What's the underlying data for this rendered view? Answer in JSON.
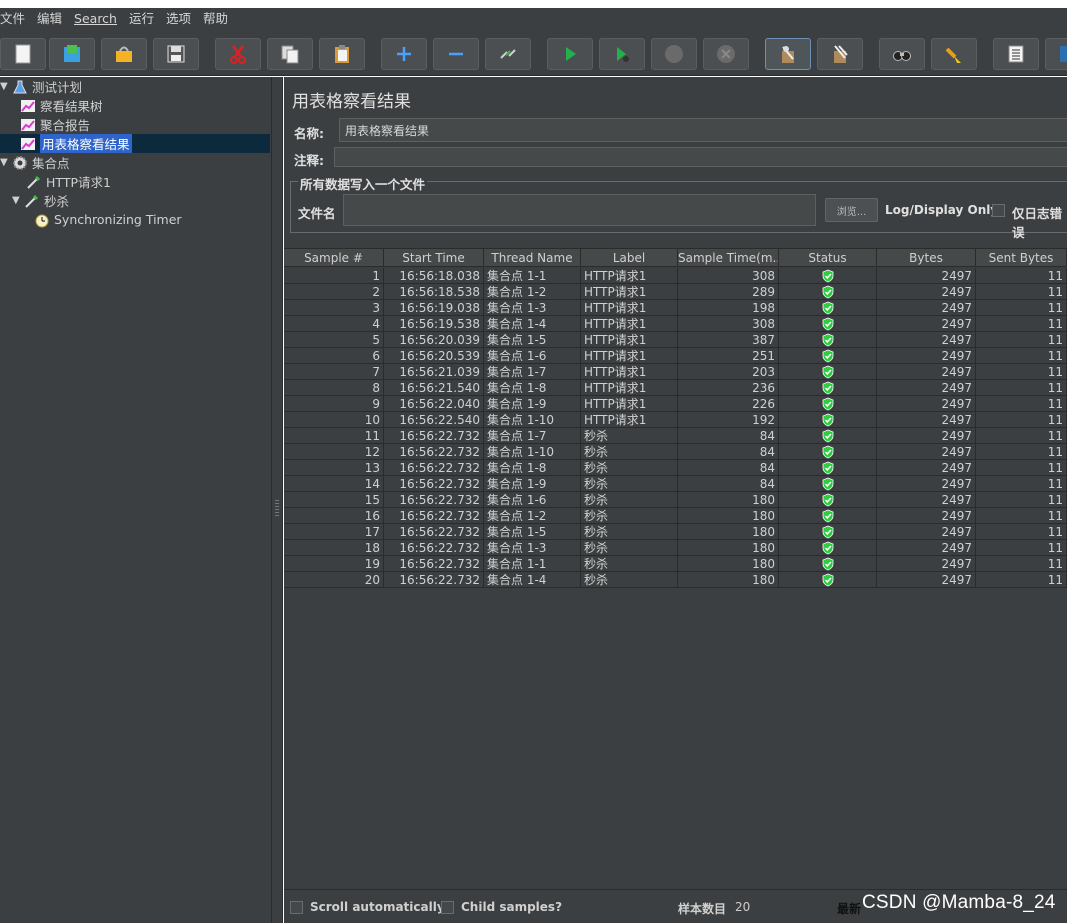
{
  "menu": [
    {
      "label": "文件",
      "underline": false
    },
    {
      "label": "编辑",
      "underline": false
    },
    {
      "label": "Search",
      "underline": true
    },
    {
      "label": "运行",
      "underline": false
    },
    {
      "label": "选项",
      "underline": false
    },
    {
      "label": "帮助",
      "underline": false
    }
  ],
  "toolbar": {
    "buttons": [
      {
        "name": "new-icon"
      },
      {
        "name": "templates-icon"
      },
      {
        "name": "open-icon"
      },
      {
        "name": "save-icon"
      },
      {
        "name": "cut-icon"
      },
      {
        "name": "copy-icon"
      },
      {
        "name": "paste-icon"
      },
      {
        "name": "expand-icon"
      },
      {
        "name": "collapse-icon"
      },
      {
        "name": "toggle-icon"
      },
      {
        "name": "start-icon"
      },
      {
        "name": "start-no-pause-icon"
      },
      {
        "name": "stop-icon"
      },
      {
        "name": "shutdown-icon"
      },
      {
        "name": "clear-icon",
        "active": true
      },
      {
        "name": "clear-all-icon"
      },
      {
        "name": "search-icon"
      },
      {
        "name": "reset-search-icon"
      },
      {
        "name": "function-helper-icon"
      },
      {
        "name": "help-icon"
      }
    ]
  },
  "tree": {
    "items": [
      {
        "label": "测试计划",
        "level": 0,
        "toggle": "▼",
        "icon": "flask-icon"
      },
      {
        "label": "察看结果树",
        "level": 1,
        "toggle": "",
        "icon": "chart-icon"
      },
      {
        "label": "聚合报告",
        "level": 1,
        "toggle": "",
        "icon": "chart-icon"
      },
      {
        "label": "用表格察看结果",
        "level": 1,
        "toggle": "",
        "icon": "chart-icon",
        "selected": true
      },
      {
        "label": "集合点",
        "level": 0,
        "toggle": "▼",
        "icon": "gear-icon"
      },
      {
        "label": "HTTP请求1",
        "level": 1,
        "toggle": "",
        "icon": "pipette-icon"
      },
      {
        "label": "秒杀",
        "level": 1,
        "toggle": "▼",
        "icon": "pipette-icon"
      },
      {
        "label": "Synchronizing Timer",
        "level": 2,
        "toggle": "",
        "icon": "timer-icon"
      }
    ]
  },
  "panel": {
    "title": "用表格察看结果",
    "name_label": "名称:",
    "name_value": "用表格察看结果",
    "comment_label": "注释:",
    "comment_value": "",
    "file_section_label": "所有数据写入一个文件",
    "filename_label": "文件名",
    "filename_value": "",
    "browse_label": "浏览...",
    "log_display_label": "Log/Display Only:",
    "errors_only_label": "仅日志错误"
  },
  "table": {
    "columns": [
      "Sample #",
      "Start Time",
      "Thread Name",
      "Label",
      "Sample Time(m...",
      "Status",
      "Bytes",
      "Sent Bytes"
    ],
    "rows": [
      [
        "1",
        "16:56:18.038",
        "集合点 1-1",
        "HTTP请求1",
        "308",
        "ok",
        "2497",
        "11"
      ],
      [
        "2",
        "16:56:18.538",
        "集合点 1-2",
        "HTTP请求1",
        "289",
        "ok",
        "2497",
        "11"
      ],
      [
        "3",
        "16:56:19.038",
        "集合点 1-3",
        "HTTP请求1",
        "198",
        "ok",
        "2497",
        "11"
      ],
      [
        "4",
        "16:56:19.538",
        "集合点 1-4",
        "HTTP请求1",
        "308",
        "ok",
        "2497",
        "11"
      ],
      [
        "5",
        "16:56:20.039",
        "集合点 1-5",
        "HTTP请求1",
        "387",
        "ok",
        "2497",
        "11"
      ],
      [
        "6",
        "16:56:20.539",
        "集合点 1-6",
        "HTTP请求1",
        "251",
        "ok",
        "2497",
        "11"
      ],
      [
        "7",
        "16:56:21.039",
        "集合点 1-7",
        "HTTP请求1",
        "203",
        "ok",
        "2497",
        "11"
      ],
      [
        "8",
        "16:56:21.540",
        "集合点 1-8",
        "HTTP请求1",
        "236",
        "ok",
        "2497",
        "11"
      ],
      [
        "9",
        "16:56:22.040",
        "集合点 1-9",
        "HTTP请求1",
        "226",
        "ok",
        "2497",
        "11"
      ],
      [
        "10",
        "16:56:22.540",
        "集合点 1-10",
        "HTTP请求1",
        "192",
        "ok",
        "2497",
        "11"
      ],
      [
        "11",
        "16:56:22.732",
        "集合点 1-7",
        "秒杀",
        "84",
        "ok",
        "2497",
        "11"
      ],
      [
        "12",
        "16:56:22.732",
        "集合点 1-10",
        "秒杀",
        "84",
        "ok",
        "2497",
        "11"
      ],
      [
        "13",
        "16:56:22.732",
        "集合点 1-8",
        "秒杀",
        "84",
        "ok",
        "2497",
        "11"
      ],
      [
        "14",
        "16:56:22.732",
        "集合点 1-9",
        "秒杀",
        "84",
        "ok",
        "2497",
        "11"
      ],
      [
        "15",
        "16:56:22.732",
        "集合点 1-6",
        "秒杀",
        "180",
        "ok",
        "2497",
        "11"
      ],
      [
        "16",
        "16:56:22.732",
        "集合点 1-2",
        "秒杀",
        "180",
        "ok",
        "2497",
        "11"
      ],
      [
        "17",
        "16:56:22.732",
        "集合点 1-5",
        "秒杀",
        "180",
        "ok",
        "2497",
        "11"
      ],
      [
        "18",
        "16:56:22.732",
        "集合点 1-3",
        "秒杀",
        "180",
        "ok",
        "2497",
        "11"
      ],
      [
        "19",
        "16:56:22.732",
        "集合点 1-1",
        "秒杀",
        "180",
        "ok",
        "2497",
        "11"
      ],
      [
        "20",
        "16:56:22.732",
        "集合点 1-4",
        "秒杀",
        "180",
        "ok",
        "2497",
        "11"
      ]
    ]
  },
  "bottom": {
    "scroll_label": "Scroll automatically?",
    "child_label": "Child samples?",
    "sample_count_label": "样本数目",
    "sample_count_value": "20",
    "latest_label": "最新"
  },
  "watermark": "CSDN @Mamba-8_24",
  "colors": {
    "ok": "#2ecc40",
    "selection": "#2f65ca",
    "background": "#3c3f41"
  }
}
